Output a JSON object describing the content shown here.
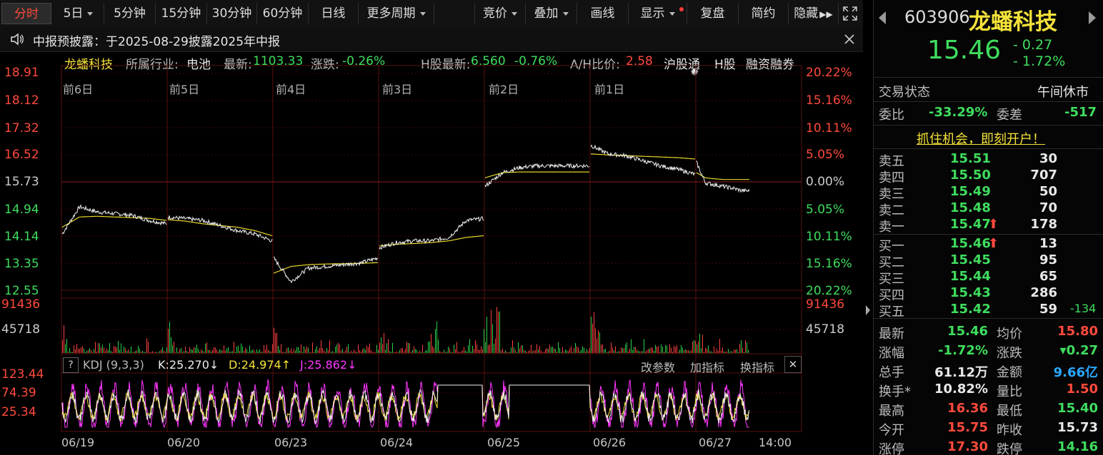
{
  "toolbar": {
    "items": [
      "分时",
      "5日",
      "5分钟",
      "15分钟",
      "30分钟",
      "60分钟",
      "日线",
      "更多周期"
    ],
    "right_items": [
      "竞价",
      "叠加",
      "画线",
      "显示",
      "复盘",
      "简约",
      "隐藏"
    ]
  },
  "notice": {
    "text": "中报预披露：于2025-08-29披露2025年中报"
  },
  "info": {
    "name": "龙蟠科技",
    "industry_label": "所属行业:",
    "industry": "电池",
    "latest_label": "最新:",
    "latest": "1103.33",
    "change_label": "涨跌:",
    "change": "-0.26%",
    "h_label": "H股最新:",
    "h_price": "6.560",
    "h_change": "-0.76%",
    "ah_label": "A/H比价:",
    "ah": "2.58",
    "tags": [
      "沪股通",
      "H股",
      "融资融券"
    ]
  },
  "chart_data": {
    "type": "line",
    "days": [
      "前6日",
      "前5日",
      "前4日",
      "前3日",
      "前2日",
      "前1日"
    ],
    "dates": [
      "06/19",
      "06/20",
      "06/23",
      "06/24",
      "06/25",
      "06/26",
      "06/27",
      "14:00"
    ],
    "price_axis": [
      "18.91",
      "18.12",
      "17.32",
      "16.52",
      "15.73",
      "14.94",
      "14.14",
      "13.35",
      "12.55"
    ],
    "pct_axis": [
      "20.22%",
      "15.16%",
      "10.11%",
      "5.05%",
      "0.00%",
      "5.05%",
      "10.11%",
      "15.16%",
      "20.22%"
    ],
    "ylim": [
      12.55,
      18.91
    ],
    "prev_close": 15.73,
    "volume_axis": [
      "91436",
      "45718"
    ],
    "kdj_axis": [
      "123.44",
      "74.39",
      "25.34"
    ],
    "series": [
      {
        "values": [
          14.2,
          15.0,
          14.85,
          14.8,
          14.75,
          14.6,
          14.5,
          14.45,
          14.3,
          14.2,
          14.0,
          13.5,
          12.8
        ]
      },
      {
        "values": [
          12.9,
          13.3,
          13.2,
          13.2,
          13.25,
          13.3,
          13.35,
          13.4,
          13.5,
          13.8,
          13.9,
          14.0,
          14.6
        ]
      },
      {
        "values": [
          15.6,
          16.0,
          16.15,
          16.2,
          16.2,
          16.2,
          16.2,
          16.2,
          16.2,
          16.2,
          16.2,
          16.2,
          16.4
        ]
      },
      {
        "values": [
          16.8,
          16.55,
          16.5,
          16.4,
          16.2,
          16.1,
          16.0,
          15.95,
          15.9,
          15.8,
          16.3,
          15.6,
          15.5,
          15.46
        ]
      }
    ]
  },
  "kdj": {
    "label": "KDJ (9,3,3)",
    "k": "K:25.270",
    "d": "D:24.974",
    "j": "J:25.862",
    "buttons": [
      "改参数",
      "加指标",
      "换指标"
    ]
  },
  "quote": {
    "code": "603906",
    "name": "龙蟠科技",
    "price": "15.46",
    "change": "- 0.27",
    "pct": "- 1.72%",
    "status_label": "交易状态",
    "status": "午间休市",
    "ratio_label": "委比",
    "ratio": "-33.29%",
    "diff_label": "委差",
    "diff": "-517",
    "promo": "抓住机会，即刻开户！",
    "asks": [
      {
        "label": "卖五",
        "price": "15.51",
        "vol": "30"
      },
      {
        "label": "卖四",
        "price": "15.50",
        "vol": "707"
      },
      {
        "label": "卖三",
        "price": "15.49",
        "vol": "50"
      },
      {
        "label": "卖二",
        "price": "15.48",
        "vol": "70"
      },
      {
        "label": "卖一",
        "price": "15.47",
        "vol": "178"
      }
    ],
    "bids": [
      {
        "label": "买一",
        "price": "15.46",
        "vol": "13"
      },
      {
        "label": "买二",
        "price": "15.45",
        "vol": "95"
      },
      {
        "label": "买三",
        "price": "15.44",
        "vol": "65"
      },
      {
        "label": "买四",
        "price": "15.43",
        "vol": "286"
      },
      {
        "label": "买五",
        "price": "15.42",
        "vol": "59",
        "extra": "-134"
      }
    ],
    "stats": [
      {
        "l1": "最新",
        "v1": "15.46",
        "l2": "均价",
        "v2": "15.80"
      },
      {
        "l1": "涨幅",
        "v1": "-1.72%",
        "l2": "涨跌",
        "v2": "▾0.27"
      },
      {
        "l1": "总手",
        "v1": "61.12万",
        "l2": "金额",
        "v2": "9.66亿"
      },
      {
        "l1": "换手*",
        "v1": "10.82%",
        "l2": "量比",
        "v2": "1.50"
      },
      {
        "l1": "最高",
        "v1": "16.36",
        "l2": "最低",
        "v2": "15.40"
      },
      {
        "l1": "今开",
        "v1": "15.75",
        "l2": "昨收",
        "v2": "15.73"
      },
      {
        "l1": "涨停",
        "v1": "17.30",
        "l2": "跌停",
        "v2": "14.16"
      }
    ]
  }
}
